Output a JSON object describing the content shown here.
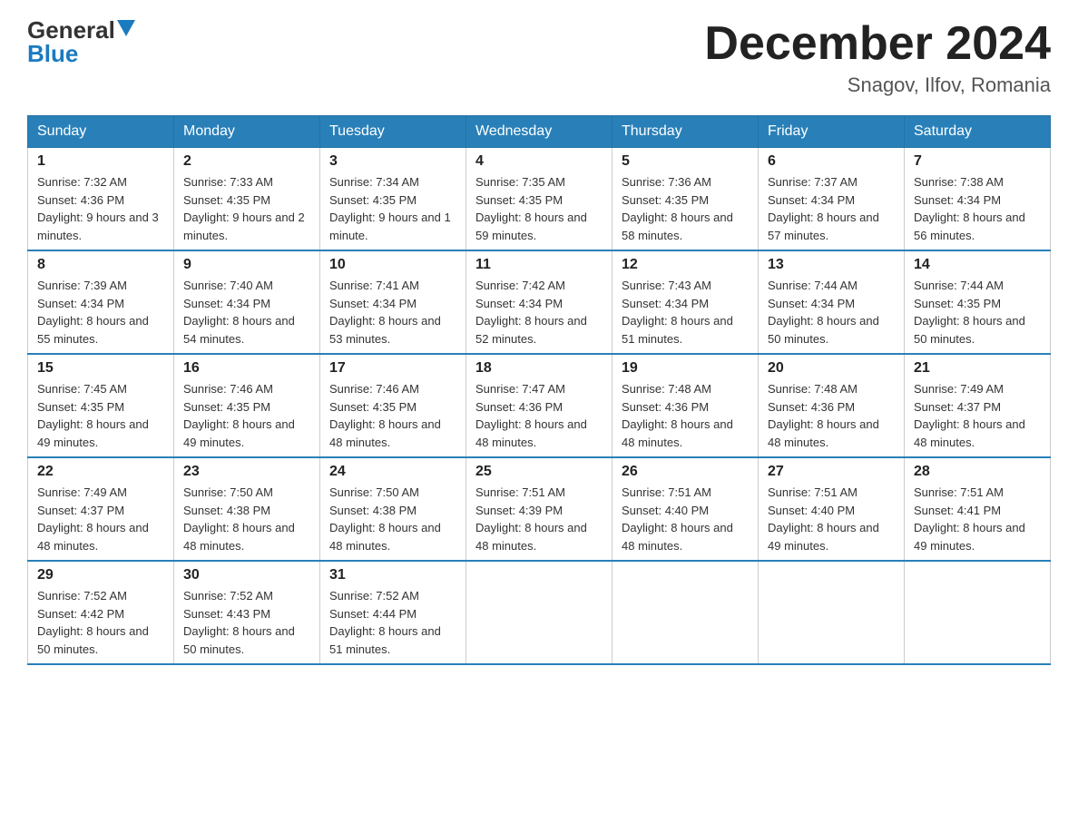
{
  "header": {
    "logo_general": "General",
    "logo_blue": "Blue",
    "month_title": "December 2024",
    "location": "Snagov, Ilfov, Romania"
  },
  "weekdays": [
    "Sunday",
    "Monday",
    "Tuesday",
    "Wednesday",
    "Thursday",
    "Friday",
    "Saturday"
  ],
  "weeks": [
    [
      {
        "day": "1",
        "sunrise": "7:32 AM",
        "sunset": "4:36 PM",
        "daylight": "9 hours and 3 minutes."
      },
      {
        "day": "2",
        "sunrise": "7:33 AM",
        "sunset": "4:35 PM",
        "daylight": "9 hours and 2 minutes."
      },
      {
        "day": "3",
        "sunrise": "7:34 AM",
        "sunset": "4:35 PM",
        "daylight": "9 hours and 1 minute."
      },
      {
        "day": "4",
        "sunrise": "7:35 AM",
        "sunset": "4:35 PM",
        "daylight": "8 hours and 59 minutes."
      },
      {
        "day": "5",
        "sunrise": "7:36 AM",
        "sunset": "4:35 PM",
        "daylight": "8 hours and 58 minutes."
      },
      {
        "day": "6",
        "sunrise": "7:37 AM",
        "sunset": "4:34 PM",
        "daylight": "8 hours and 57 minutes."
      },
      {
        "day": "7",
        "sunrise": "7:38 AM",
        "sunset": "4:34 PM",
        "daylight": "8 hours and 56 minutes."
      }
    ],
    [
      {
        "day": "8",
        "sunrise": "7:39 AM",
        "sunset": "4:34 PM",
        "daylight": "8 hours and 55 minutes."
      },
      {
        "day": "9",
        "sunrise": "7:40 AM",
        "sunset": "4:34 PM",
        "daylight": "8 hours and 54 minutes."
      },
      {
        "day": "10",
        "sunrise": "7:41 AM",
        "sunset": "4:34 PM",
        "daylight": "8 hours and 53 minutes."
      },
      {
        "day": "11",
        "sunrise": "7:42 AM",
        "sunset": "4:34 PM",
        "daylight": "8 hours and 52 minutes."
      },
      {
        "day": "12",
        "sunrise": "7:43 AM",
        "sunset": "4:34 PM",
        "daylight": "8 hours and 51 minutes."
      },
      {
        "day": "13",
        "sunrise": "7:44 AM",
        "sunset": "4:34 PM",
        "daylight": "8 hours and 50 minutes."
      },
      {
        "day": "14",
        "sunrise": "7:44 AM",
        "sunset": "4:35 PM",
        "daylight": "8 hours and 50 minutes."
      }
    ],
    [
      {
        "day": "15",
        "sunrise": "7:45 AM",
        "sunset": "4:35 PM",
        "daylight": "8 hours and 49 minutes."
      },
      {
        "day": "16",
        "sunrise": "7:46 AM",
        "sunset": "4:35 PM",
        "daylight": "8 hours and 49 minutes."
      },
      {
        "day": "17",
        "sunrise": "7:46 AM",
        "sunset": "4:35 PM",
        "daylight": "8 hours and 48 minutes."
      },
      {
        "day": "18",
        "sunrise": "7:47 AM",
        "sunset": "4:36 PM",
        "daylight": "8 hours and 48 minutes."
      },
      {
        "day": "19",
        "sunrise": "7:48 AM",
        "sunset": "4:36 PM",
        "daylight": "8 hours and 48 minutes."
      },
      {
        "day": "20",
        "sunrise": "7:48 AM",
        "sunset": "4:36 PM",
        "daylight": "8 hours and 48 minutes."
      },
      {
        "day": "21",
        "sunrise": "7:49 AM",
        "sunset": "4:37 PM",
        "daylight": "8 hours and 48 minutes."
      }
    ],
    [
      {
        "day": "22",
        "sunrise": "7:49 AM",
        "sunset": "4:37 PM",
        "daylight": "8 hours and 48 minutes."
      },
      {
        "day": "23",
        "sunrise": "7:50 AM",
        "sunset": "4:38 PM",
        "daylight": "8 hours and 48 minutes."
      },
      {
        "day": "24",
        "sunrise": "7:50 AM",
        "sunset": "4:38 PM",
        "daylight": "8 hours and 48 minutes."
      },
      {
        "day": "25",
        "sunrise": "7:51 AM",
        "sunset": "4:39 PM",
        "daylight": "8 hours and 48 minutes."
      },
      {
        "day": "26",
        "sunrise": "7:51 AM",
        "sunset": "4:40 PM",
        "daylight": "8 hours and 48 minutes."
      },
      {
        "day": "27",
        "sunrise": "7:51 AM",
        "sunset": "4:40 PM",
        "daylight": "8 hours and 49 minutes."
      },
      {
        "day": "28",
        "sunrise": "7:51 AM",
        "sunset": "4:41 PM",
        "daylight": "8 hours and 49 minutes."
      }
    ],
    [
      {
        "day": "29",
        "sunrise": "7:52 AM",
        "sunset": "4:42 PM",
        "daylight": "8 hours and 50 minutes."
      },
      {
        "day": "30",
        "sunrise": "7:52 AM",
        "sunset": "4:43 PM",
        "daylight": "8 hours and 50 minutes."
      },
      {
        "day": "31",
        "sunrise": "7:52 AM",
        "sunset": "4:44 PM",
        "daylight": "8 hours and 51 minutes."
      },
      null,
      null,
      null,
      null
    ]
  ],
  "labels": {
    "sunrise": "Sunrise:",
    "sunset": "Sunset:",
    "daylight": "Daylight:"
  }
}
